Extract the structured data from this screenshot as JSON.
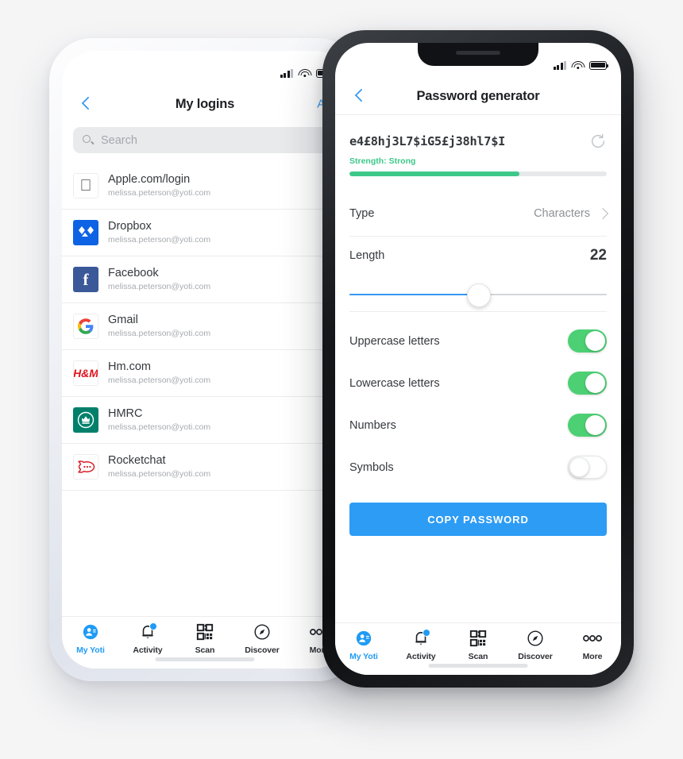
{
  "background_color": "#f5f5f6",
  "accent_blue": "#3399f3",
  "toggle_green": "#4cd073",
  "strength_green": "#3dc88a",
  "phones": {
    "left": {
      "frame_color": "#e9ebf1",
      "status": {
        "signal": "signal-bars",
        "wifi": "wifi-icon",
        "battery": "battery-icon"
      },
      "nav": {
        "back": "chevron-left-icon",
        "title": "My logins",
        "action": "Add"
      },
      "search": {
        "icon": "search-icon",
        "placeholder": "Search",
        "value": ""
      },
      "logins": [
        {
          "title": "Apple.com/login",
          "subtitle": "melissa.peterson@yoti.com",
          "logo": "apple-logo"
        },
        {
          "title": "Dropbox",
          "subtitle": "melissa.peterson@yoti.com",
          "logo": "dropbox-logo"
        },
        {
          "title": "Facebook",
          "subtitle": "melissa.peterson@yoti.com",
          "logo": "facebook-logo"
        },
        {
          "title": "Gmail",
          "subtitle": "melissa.peterson@yoti.com",
          "logo": "google-logo"
        },
        {
          "title": "Hm.com",
          "subtitle": "melissa.peterson@yoti.com",
          "logo": "hm-logo"
        },
        {
          "title": "HMRC",
          "subtitle": "melissa.peterson@yoti.com",
          "logo": "hmrc-logo"
        },
        {
          "title": "Rocketchat",
          "subtitle": "melissa.peterson@yoti.com",
          "logo": "rocketchat-logo"
        }
      ],
      "tabs": [
        {
          "label": "My Yoti",
          "icon": "person-badge-icon",
          "active": true,
          "badge": false
        },
        {
          "label": "Activity",
          "icon": "bell-icon",
          "active": false,
          "badge": true
        },
        {
          "label": "Scan",
          "icon": "qr-code-icon",
          "active": false,
          "badge": false
        },
        {
          "label": "Discover",
          "icon": "compass-icon",
          "active": false,
          "badge": false
        },
        {
          "label": "More",
          "icon": "ellipsis-icon",
          "active": false,
          "badge": false
        }
      ]
    },
    "right": {
      "frame_color": "#15171a",
      "status": {
        "signal": "signal-bars",
        "wifi": "wifi-icon",
        "battery": "battery-icon"
      },
      "nav": {
        "back": "chevron-left-icon",
        "title": "Password generator"
      },
      "password": {
        "value": "e4£8hj3L7$iG5£j38hl7$I",
        "refresh_icon": "refresh-icon",
        "strength_label": "Strength: Strong",
        "strength_percent": 66
      },
      "settings": {
        "type_label": "Type",
        "type_value": "Characters",
        "type_chevron": "chevron-right-icon",
        "length_label": "Length",
        "length_value": "22",
        "length_percent": 50
      },
      "toggles": [
        {
          "label": "Uppercase letters",
          "state": "on"
        },
        {
          "label": "Lowercase letters",
          "state": "on"
        },
        {
          "label": "Numbers",
          "state": "on"
        },
        {
          "label": "Symbols",
          "state": "off"
        }
      ],
      "copy_button": "COPY PASSWORD",
      "tabs": [
        {
          "label": "My Yoti",
          "icon": "person-badge-icon",
          "active": true,
          "badge": false
        },
        {
          "label": "Activity",
          "icon": "bell-icon",
          "active": false,
          "badge": true
        },
        {
          "label": "Scan",
          "icon": "qr-code-icon",
          "active": false,
          "badge": false
        },
        {
          "label": "Discover",
          "icon": "compass-icon",
          "active": false,
          "badge": false
        },
        {
          "label": "More",
          "icon": "ellipsis-icon",
          "active": false,
          "badge": false
        }
      ]
    }
  }
}
